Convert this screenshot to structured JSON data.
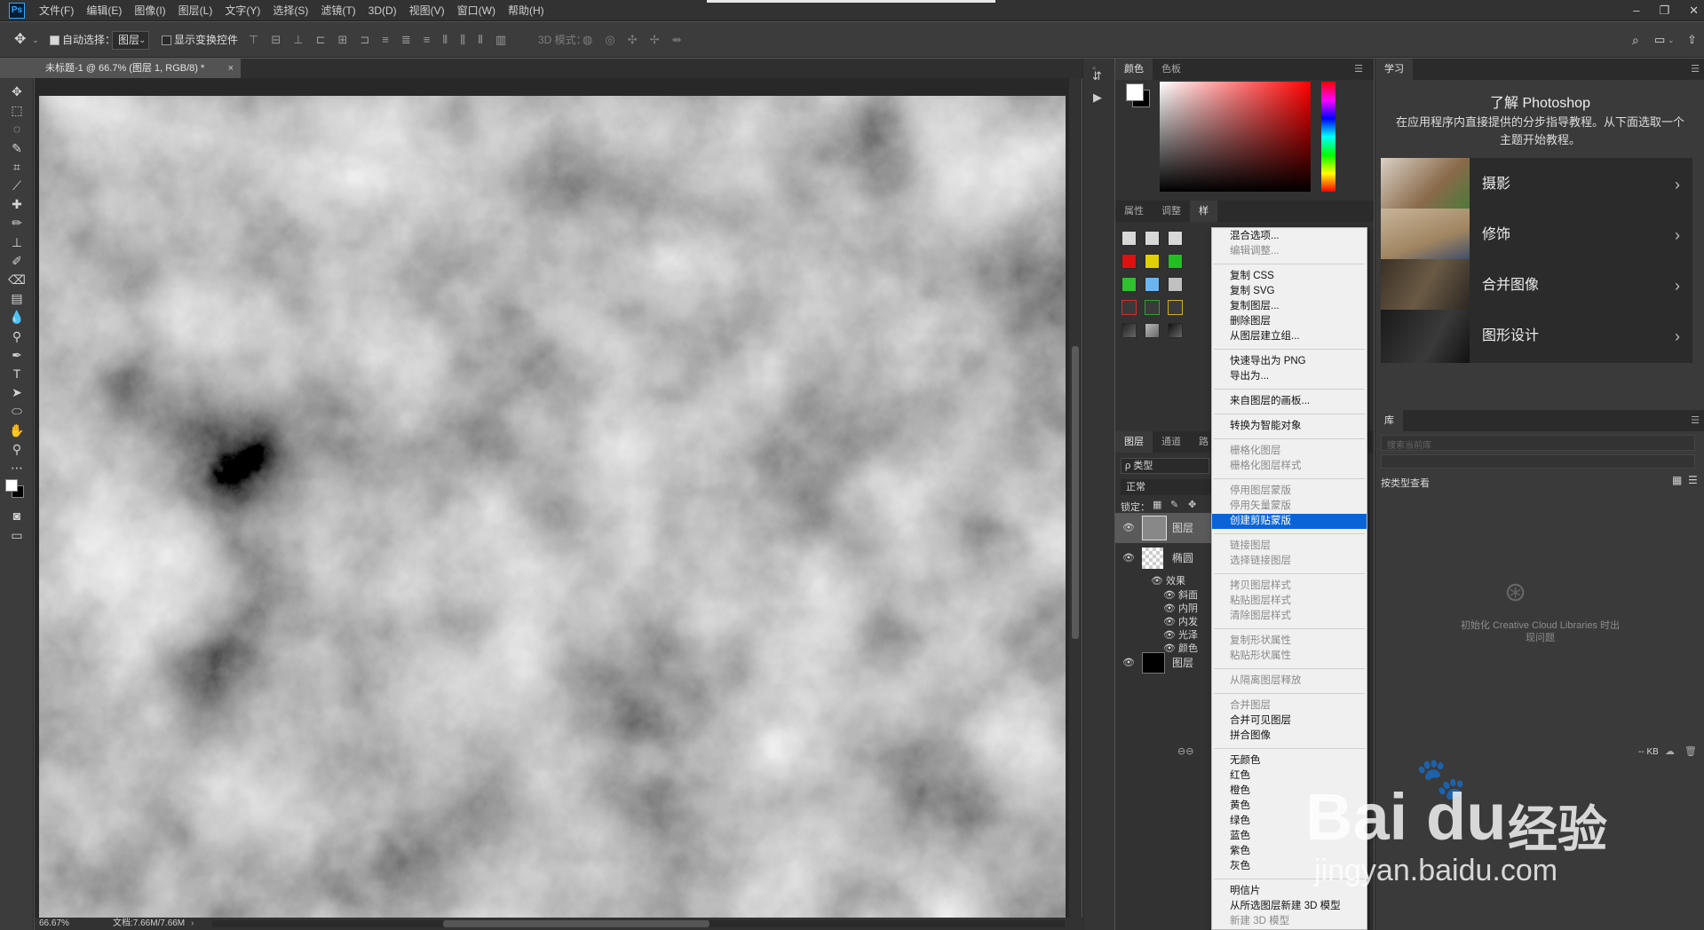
{
  "app": {
    "logo": "Ps",
    "menus": [
      "文件(F)",
      "编辑(E)",
      "图像(I)",
      "图层(L)",
      "文字(Y)",
      "选择(S)",
      "滤镜(T)",
      "3D(D)",
      "视图(V)",
      "窗口(W)",
      "帮助(H)"
    ]
  },
  "options": {
    "auto_select": "自动选择：",
    "auto_select_target": "图层",
    "show_transform": "显示变换控件",
    "mode3d": "3D 模式："
  },
  "document": {
    "tab_title": "未标题-1 @ 66.7% (图层 1, RGB/8) *",
    "close": "×"
  },
  "status": {
    "zoom": "66.67%",
    "doc_size": "文档:7.66M/7.66M"
  },
  "panels": {
    "color_tabs": [
      "颜色",
      "色板"
    ],
    "props_tabs": [
      "属性",
      "调整",
      "样"
    ],
    "layers_tabs": [
      "图层",
      "通道",
      "路"
    ],
    "filter_kind": "ρ 类型",
    "blend_mode": "正常",
    "lock_label": "锁定：",
    "layers": [
      {
        "name": "图层"
      },
      {
        "name": "椭圆"
      },
      {
        "name": "图层"
      }
    ],
    "effects_label": "效果",
    "effects": [
      "斜面",
      "内阴",
      "内发",
      "光泽",
      "颜色"
    ]
  },
  "learn": {
    "tab": "学习",
    "title": "了解 Photoshop",
    "desc": "在应用程序内直接提供的分步指导教程。从下面选取一个主题开始教程。",
    "cards": [
      "摄影",
      "修饰",
      "合并图像",
      "图形设计"
    ]
  },
  "library": {
    "tab": "库",
    "search_placeholder": "搜索当前库",
    "view_by": "按类型查看",
    "error_msg_1": "初始化 Creative Cloud Libraries 时出",
    "error_msg_2": "现问题",
    "size": "-- KB"
  },
  "context_menu": {
    "groups": [
      [
        {
          "label": "混合选项...",
          "enabled": true
        },
        {
          "label": "编辑调整...",
          "enabled": false
        }
      ],
      [
        {
          "label": "复制 CSS",
          "enabled": true
        },
        {
          "label": "复制 SVG",
          "enabled": true
        },
        {
          "label": "复制图层...",
          "enabled": true
        },
        {
          "label": "删除图层",
          "enabled": true
        },
        {
          "label": "从图层建立组...",
          "enabled": true
        }
      ],
      [
        {
          "label": "快速导出为 PNG",
          "enabled": true
        },
        {
          "label": "导出为...",
          "enabled": true
        }
      ],
      [
        {
          "label": "来自图层的画板...",
          "enabled": true
        }
      ],
      [
        {
          "label": "转换为智能对象",
          "enabled": true
        }
      ],
      [
        {
          "label": "栅格化图层",
          "enabled": false
        },
        {
          "label": "栅格化图层样式",
          "enabled": false
        }
      ],
      [
        {
          "label": "停用图层蒙版",
          "enabled": false
        },
        {
          "label": "停用矢量蒙版",
          "enabled": false
        },
        {
          "label": "创建剪贴蒙版",
          "enabled": true,
          "highlighted": true
        }
      ],
      [
        {
          "label": "链接图层",
          "enabled": false
        },
        {
          "label": "选择链接图层",
          "enabled": false
        }
      ],
      [
        {
          "label": "拷贝图层样式",
          "enabled": false
        },
        {
          "label": "粘贴图层样式",
          "enabled": false
        },
        {
          "label": "清除图层样式",
          "enabled": false
        }
      ],
      [
        {
          "label": "复制形状属性",
          "enabled": false
        },
        {
          "label": "粘贴形状属性",
          "enabled": false
        }
      ],
      [
        {
          "label": "从隔离图层释放",
          "enabled": false
        }
      ],
      [
        {
          "label": "合并图层",
          "enabled": false
        },
        {
          "label": "合并可见图层",
          "enabled": true
        },
        {
          "label": "拼合图像",
          "enabled": true
        }
      ],
      [
        {
          "label": "无颜色",
          "enabled": true
        },
        {
          "label": "红色",
          "enabled": true
        },
        {
          "label": "橙色",
          "enabled": true
        },
        {
          "label": "黄色",
          "enabled": true
        },
        {
          "label": "绿色",
          "enabled": true
        },
        {
          "label": "蓝色",
          "enabled": true
        },
        {
          "label": "紫色",
          "enabled": true
        },
        {
          "label": "灰色",
          "enabled": true
        }
      ],
      [
        {
          "label": "明信片",
          "enabled": true
        },
        {
          "label": "从所选图层新建 3D 模型",
          "enabled": true
        },
        {
          "label": "新建 3D 模型",
          "enabled": false
        }
      ]
    ]
  },
  "watermark": {
    "brand": "Bai",
    "brand2": "du",
    "brand_cn": "经验",
    "url": "jingyan.baidu.com"
  }
}
